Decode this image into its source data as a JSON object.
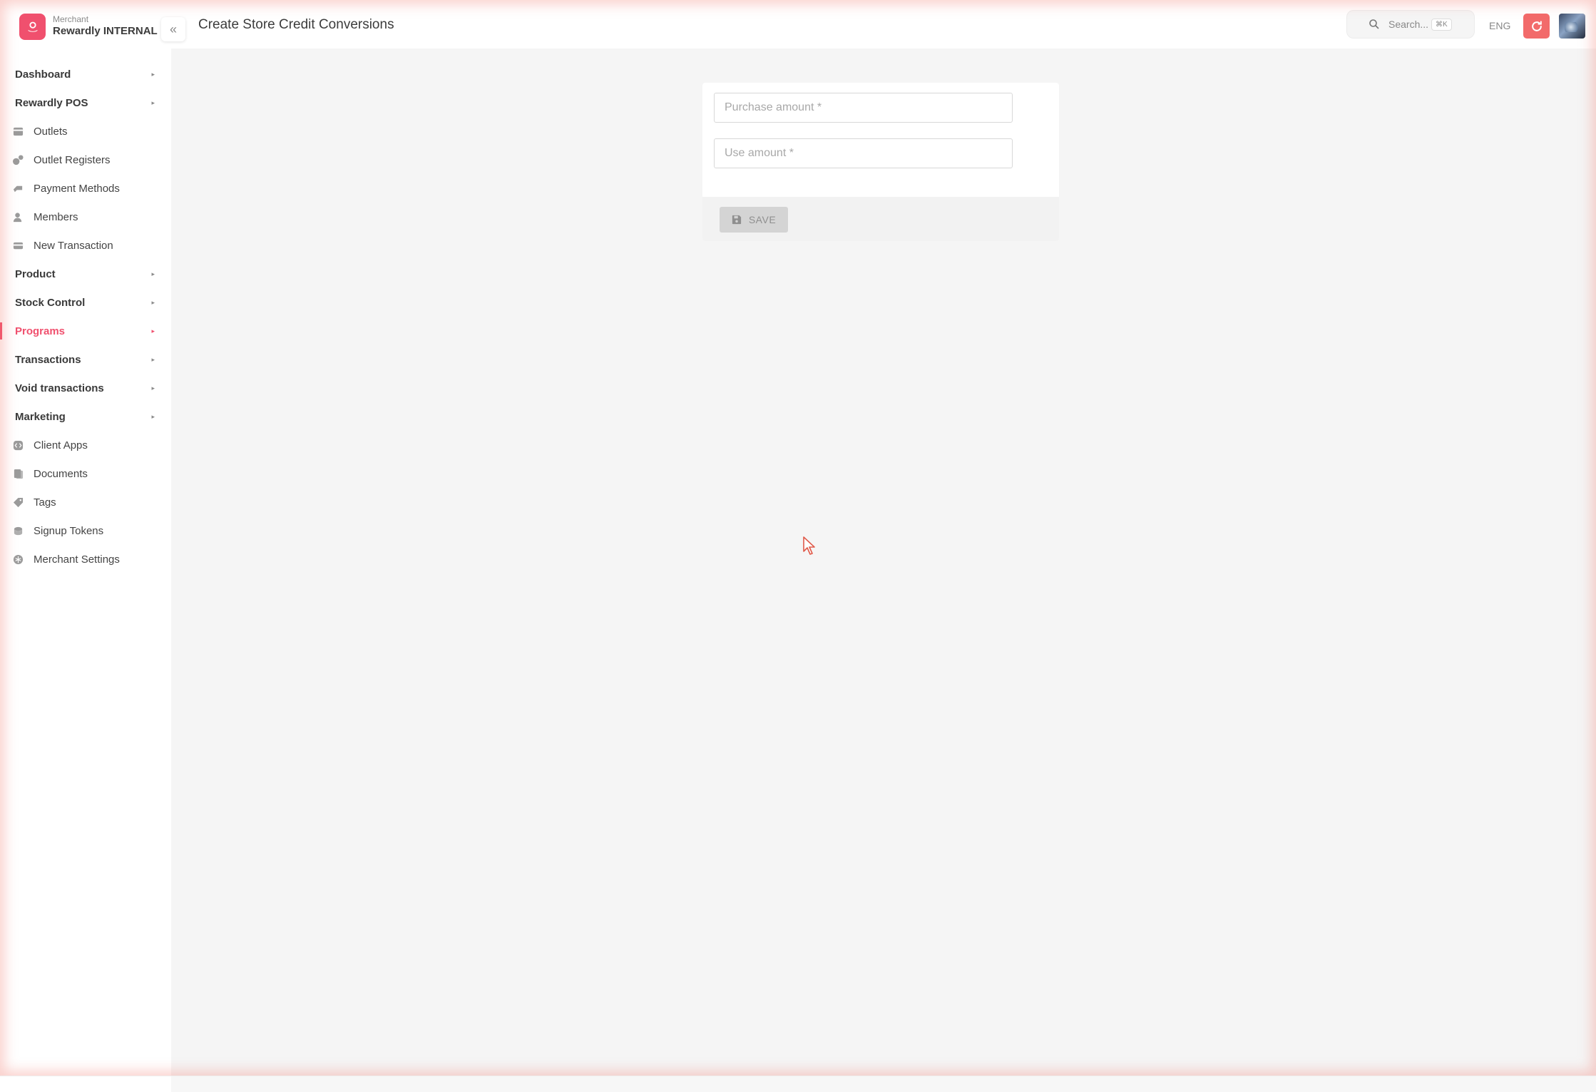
{
  "brand": {
    "subtitle": "Merchant",
    "name": "Rewardly INTERNAL"
  },
  "header": {
    "title": "Create Store Credit Conversions",
    "search_placeholder": "Search...",
    "search_shortcut": "⌘K",
    "language": "ENG"
  },
  "sidebar": {
    "items": [
      {
        "label": "Dashboard",
        "type": "group"
      },
      {
        "label": "Rewardly POS",
        "type": "group"
      },
      {
        "label": "Outlets",
        "type": "sub",
        "icon": "store-icon"
      },
      {
        "label": "Outlet Registers",
        "type": "sub",
        "icon": "register-icon"
      },
      {
        "label": "Payment Methods",
        "type": "sub",
        "icon": "payment-icon"
      },
      {
        "label": "Members",
        "type": "sub",
        "icon": "user-icon"
      },
      {
        "label": "New Transaction",
        "type": "sub",
        "icon": "card-icon"
      },
      {
        "label": "Product",
        "type": "group"
      },
      {
        "label": "Stock Control",
        "type": "group"
      },
      {
        "label": "Programs",
        "type": "group",
        "active": true
      },
      {
        "label": "Transactions",
        "type": "group"
      },
      {
        "label": "Void transactions",
        "type": "group"
      },
      {
        "label": "Marketing",
        "type": "group"
      },
      {
        "label": "Client Apps",
        "type": "sub",
        "icon": "code-icon"
      },
      {
        "label": "Documents",
        "type": "sub",
        "icon": "document-icon"
      },
      {
        "label": "Tags",
        "type": "sub",
        "icon": "tag-icon"
      },
      {
        "label": "Signup Tokens",
        "type": "sub",
        "icon": "token-icon"
      },
      {
        "label": "Merchant Settings",
        "type": "sub",
        "icon": "settings-icon"
      }
    ]
  },
  "form": {
    "purchase_amount": {
      "placeholder": "Purchase amount *",
      "value": ""
    },
    "use_amount": {
      "placeholder": "Use amount *",
      "value": ""
    },
    "save_label": "SAVE"
  },
  "colors": {
    "accent": "#f0506e",
    "refresh": "#f26a6a",
    "background": "#f5f5f5"
  }
}
